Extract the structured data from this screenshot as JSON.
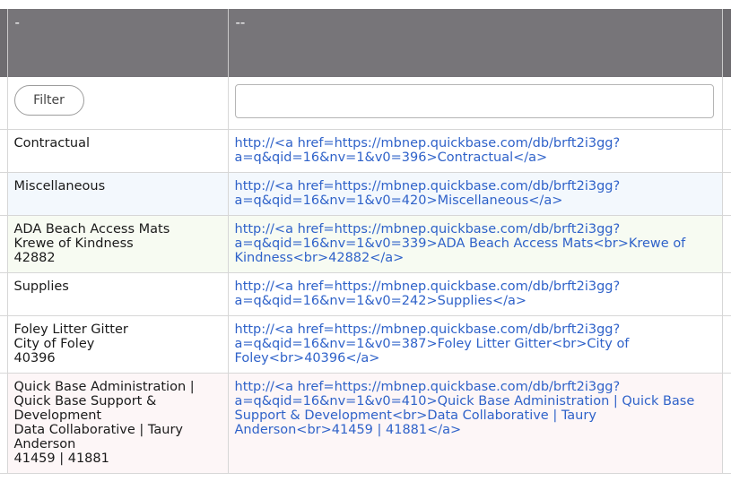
{
  "header": {
    "col1_label": "-",
    "col2_label": "--"
  },
  "filter": {
    "button_label": "Filter",
    "input_value": "",
    "input_placeholder": ""
  },
  "rows": [
    {
      "name_lines": [
        "Contractual"
      ],
      "link_text": "http://<a href=https://mbnep.quickbase.com/db/brft2i3gg?a=q&qid=16&nv=1&v0=396>Contractual</a>"
    },
    {
      "name_lines": [
        "Miscellaneous"
      ],
      "link_text": "http://<a href=https://mbnep.quickbase.com/db/brft2i3gg?a=q&qid=16&nv=1&v0=420>Miscellaneous</a>"
    },
    {
      "name_lines": [
        "ADA Beach Access Mats",
        "Krewe of Kindness",
        "42882"
      ],
      "link_text": "http://<a href=https://mbnep.quickbase.com/db/brft2i3gg?a=q&qid=16&nv=1&v0=339>ADA Beach Access Mats<br>Krewe of Kindness<br>42882</a>"
    },
    {
      "name_lines": [
        "Supplies"
      ],
      "link_text": "http://<a href=https://mbnep.quickbase.com/db/brft2i3gg?a=q&qid=16&nv=1&v0=242>Supplies</a>"
    },
    {
      "name_lines": [
        "Foley Litter Gitter",
        "City of Foley",
        "40396"
      ],
      "link_text": "http://<a href=https://mbnep.quickbase.com/db/brft2i3gg?a=q&qid=16&nv=1&v0=387>Foley Litter Gitter<br>City of Foley<br>40396</a>"
    },
    {
      "name_lines": [
        "Quick Base Administration | Quick Base Support & Development",
        "Data Collaborative | Taury Anderson",
        "41459 | 41881"
      ],
      "link_text": "http://<a href=https://mbnep.quickbase.com/db/brft2i3gg?a=q&qid=16&nv=1&v0=410>Quick Base Administration | Quick Base Support & Development<br>Data Collaborative | Taury Anderson<br>41459 | 41881</a>"
    }
  ],
  "colors": {
    "header_bg": "#777579",
    "link": "#2f62c9",
    "row_blue": "#f3f8fd",
    "row_green": "#f7fbf2",
    "row_pink": "#fdf6f7"
  }
}
